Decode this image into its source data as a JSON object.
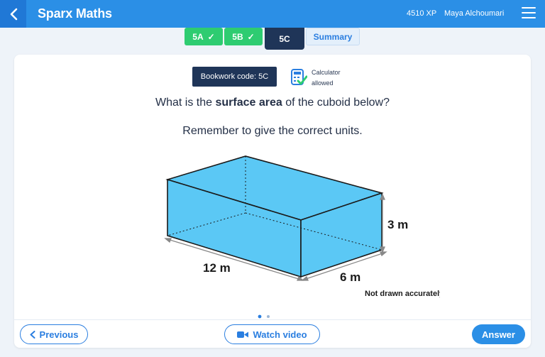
{
  "header": {
    "app_title": "Sparx Maths",
    "xp": "4510 XP",
    "user_name": "Maya Alchoumari"
  },
  "tabs": [
    {
      "label": "5A",
      "state": "complete"
    },
    {
      "label": "5B",
      "state": "complete"
    },
    {
      "label": "5C",
      "state": "active"
    },
    {
      "label": "Summary",
      "state": "link"
    }
  ],
  "task": {
    "bookwork_code": "Bookwork code: 5C",
    "calculator_line1": "Calculator",
    "calculator_line2": "allowed",
    "question_before": "What is the ",
    "question_bold": "surface area",
    "question_after": " of the cuboid below?",
    "instruction": "Remember to give the correct units."
  },
  "diagram": {
    "length_label": "12 m",
    "width_label": "6 m",
    "height_label": "3 m",
    "note": "Not drawn accurately",
    "fill_color": "#5bc8f5"
  },
  "footer": {
    "previous_label": "Previous",
    "watch_label": "Watch video",
    "answer_label": "Answer"
  },
  "colors": {
    "header_blue": "#2b8fe6",
    "navy": "#1f3558",
    "done_green": "#2ecc71"
  }
}
